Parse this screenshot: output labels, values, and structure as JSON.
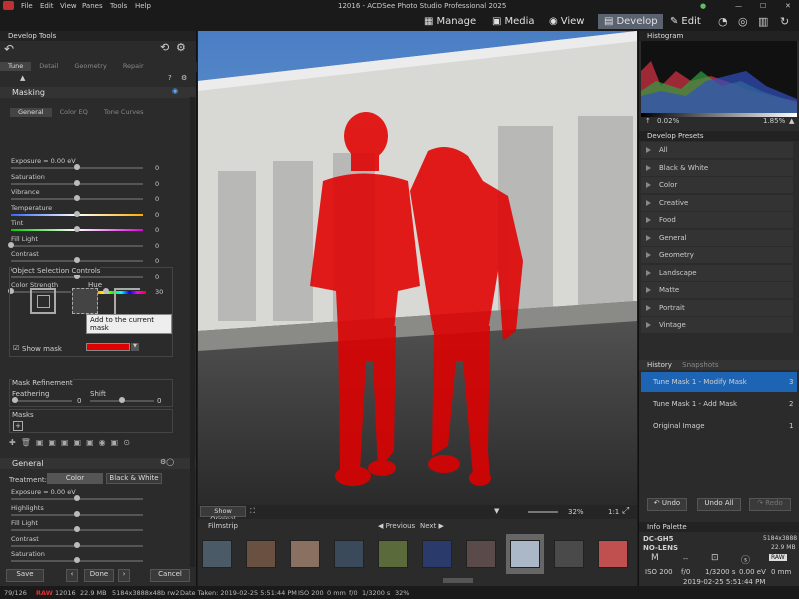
{
  "window": {
    "title": "12016 - ACDSee Photo Studio Professional 2025"
  },
  "menu": [
    "File",
    "Edit",
    "View",
    "Panes",
    "Tools",
    "Help"
  ],
  "modes": [
    {
      "label": "Manage"
    },
    {
      "label": "Media"
    },
    {
      "label": "View"
    },
    {
      "label": "Develop",
      "active": true
    },
    {
      "label": "Edit"
    }
  ],
  "left": {
    "title": "Develop Tools",
    "tabs": [
      "Tune",
      "Detail",
      "Geometry",
      "Repair"
    ],
    "masking": {
      "title": "Masking",
      "subtabs": [
        "General",
        "Color EQ",
        "Tone Curves"
      ],
      "sliders": [
        {
          "label": "Exposure = 0.00 eV",
          "value": "0",
          "pos": 0.5
        },
        {
          "label": "Saturation",
          "value": "0",
          "pos": 0.5
        },
        {
          "label": "Vibrance",
          "value": "0",
          "pos": 0.5
        },
        {
          "label": "Temperature",
          "value": "0",
          "pos": 0.5
        },
        {
          "label": "Tint",
          "value": "0",
          "pos": 0.5
        },
        {
          "label": "Fill Light",
          "value": "0",
          "pos": 0.0
        },
        {
          "label": "Contrast",
          "value": "0",
          "pos": 0.5
        },
        {
          "label": "Clarity",
          "value": "0",
          "pos": 0.5
        },
        {
          "label": "Color Strength",
          "value": "0"
        }
      ],
      "hue_label": "Hue",
      "hue_value": "30",
      "osc_title": "Object Selection Controls",
      "tooltip": "Add to the current mask",
      "show_mask": "Show mask",
      "refine_title": "Mask Refinement",
      "feathering": "Feathering",
      "feathering_value": "0",
      "shift": "Shift",
      "shift_value": "0",
      "masks_title": "Masks"
    },
    "general": {
      "title": "General",
      "treatment": "Treatment:",
      "color_btn": "Color",
      "bw_btn": "Black & White",
      "sliders": [
        {
          "label": "Exposure = 0.00 eV"
        },
        {
          "label": "Highlights"
        },
        {
          "label": "Fill Light"
        },
        {
          "label": "Contrast"
        },
        {
          "label": "Saturation"
        }
      ]
    },
    "buttons": {
      "save": "Save",
      "done": "Done",
      "cancel": "Cancel"
    }
  },
  "viewer": {
    "show_original": "Show Original",
    "zoom": "32%",
    "ratio": "1:1"
  },
  "filmstrip": {
    "title": "Filmstrip",
    "previous": "Previous",
    "next": "Next"
  },
  "right": {
    "histogram": {
      "title": "Histogram",
      "left_pct": "0.02%",
      "right_pct": "1.85%"
    },
    "presets": {
      "title": "Develop Presets",
      "items": [
        "All",
        "Black & White",
        "Color",
        "Creative",
        "Food",
        "General",
        "Geometry",
        "Landscape",
        "Matte",
        "Portrait",
        "Vintage"
      ]
    },
    "history": {
      "title": "History",
      "tab2": "Snapshots",
      "items": [
        {
          "label": "Tune Mask 1 - Modify Mask",
          "num": "3"
        },
        {
          "label": "Tune Mask 1 - Add Mask",
          "num": "2"
        },
        {
          "label": "Original Image",
          "num": "1"
        }
      ],
      "undo": "Undo",
      "undo_all": "Undo All",
      "redo": "Redo"
    },
    "info": {
      "title": "Info Palette",
      "camera": "DC-GH5",
      "lens": "NO-LENS",
      "dims": "5184x3888",
      "size": "22.9 MB",
      "m": "M",
      "dash": "--",
      "raw": "RAW",
      "iso": "ISO 200",
      "f": "f/0",
      "shutter": "1/3200 s",
      "ev": "0.00 eV",
      "mm": "0 mm",
      "date": "2019-02-25 5:51:44 PM"
    }
  },
  "status": {
    "index": "79/126",
    "raw": "RAW",
    "num": "12016",
    "size": "22.9 MB",
    "file": "5184x3888x48b rw2",
    "date": "Date Taken: 2019-02-25 5:51:44 PM",
    "iso": "ISO 200",
    "mm": "0 mm",
    "f": "f/0",
    "shutter": "1/3200 s",
    "zoom": "32%"
  }
}
